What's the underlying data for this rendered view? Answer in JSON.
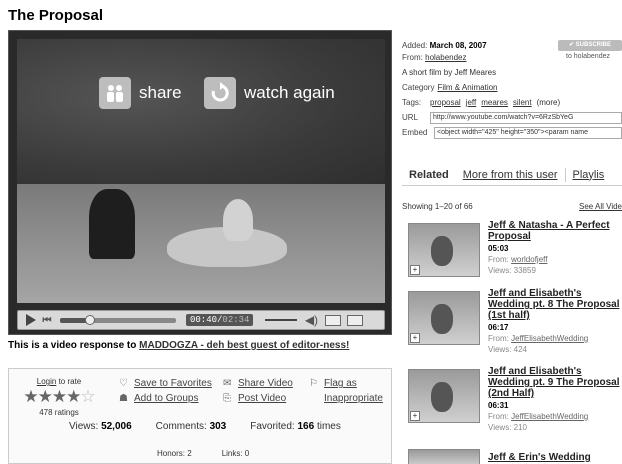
{
  "page": {
    "title": "The Proposal"
  },
  "player": {
    "share_label": "share",
    "watch_again_label": "watch again",
    "time_current": "00:40",
    "time_separator": "/",
    "time_total": "02:34",
    "progress_fraction": 0.26
  },
  "response": {
    "prefix": "This is a video response to",
    "link": "MADDOGZA - deh best guest of editor-ness!"
  },
  "rating": {
    "login_label": "Login",
    "suffix": "to rate",
    "stars_filled": "★★★★",
    "stars_empty": "☆",
    "count": "478 ratings"
  },
  "actions": {
    "save_favorites": "Save to Favorites",
    "share_video": "Share Video",
    "flag_line1": "Flag as",
    "add_groups": "Add to Groups",
    "post_video": "Post Video",
    "flag_line2": "Inappropriate"
  },
  "stats": {
    "views_label": "Views:",
    "views": "52,006",
    "comments_label": "Comments:",
    "comments": "303",
    "favorited_label": "Favorited:",
    "favorited": "166",
    "favorited_suffix": "times",
    "honors": "Honors: 2",
    "links": "Links: 0"
  },
  "meta": {
    "added_label": "Added:",
    "added": "March 08, 2007",
    "from_label": "From:",
    "from": "holabendez",
    "subscribe_label": "✔ SUBSCRIBE",
    "subscribe_target": "to holabendez",
    "description": "A short film by Jeff Meares",
    "category_label": "Category",
    "category": "Film & Animation",
    "tags_label": "Tags:",
    "tags": [
      "proposal",
      "jeff",
      "meares",
      "silent"
    ],
    "tags_more": "(more)",
    "url_label": "URL",
    "url_value": "http://www.youtube.com/watch?v=6RzSbYeG",
    "embed_label": "Embed",
    "embed_value": "<object width=\"425\" height=\"350\"><param name"
  },
  "tabs": {
    "related": "Related",
    "more_from_user": "More from this user",
    "playlists": "Playlis"
  },
  "listing": {
    "showing": "Showing 1–20 of 66",
    "see_all": "See All Vide"
  },
  "related": [
    {
      "title": "Jeff & Natasha - A Perfect Proposal",
      "duration": "05:03",
      "from_label": "From:",
      "from": "worldofjeff",
      "views": "Views: 33859"
    },
    {
      "title": "Jeff and Elisabeth's Wedding pt. 8 The Proposal (1st half)",
      "duration": "06:17",
      "from_label": "From:",
      "from": "JeffElisabethWedding",
      "views": "Views: 424"
    },
    {
      "title": "Jeff and Elisabeth's Wedding pt. 9 The Proposal (2nd Half)",
      "duration": "06:31",
      "from_label": "From:",
      "from": "JeffElisabethWedding",
      "views": "Views: 210"
    },
    {
      "title": "Jeff & Erin's Wedding",
      "duration": "",
      "from_label": "",
      "from": "",
      "views": ""
    }
  ]
}
